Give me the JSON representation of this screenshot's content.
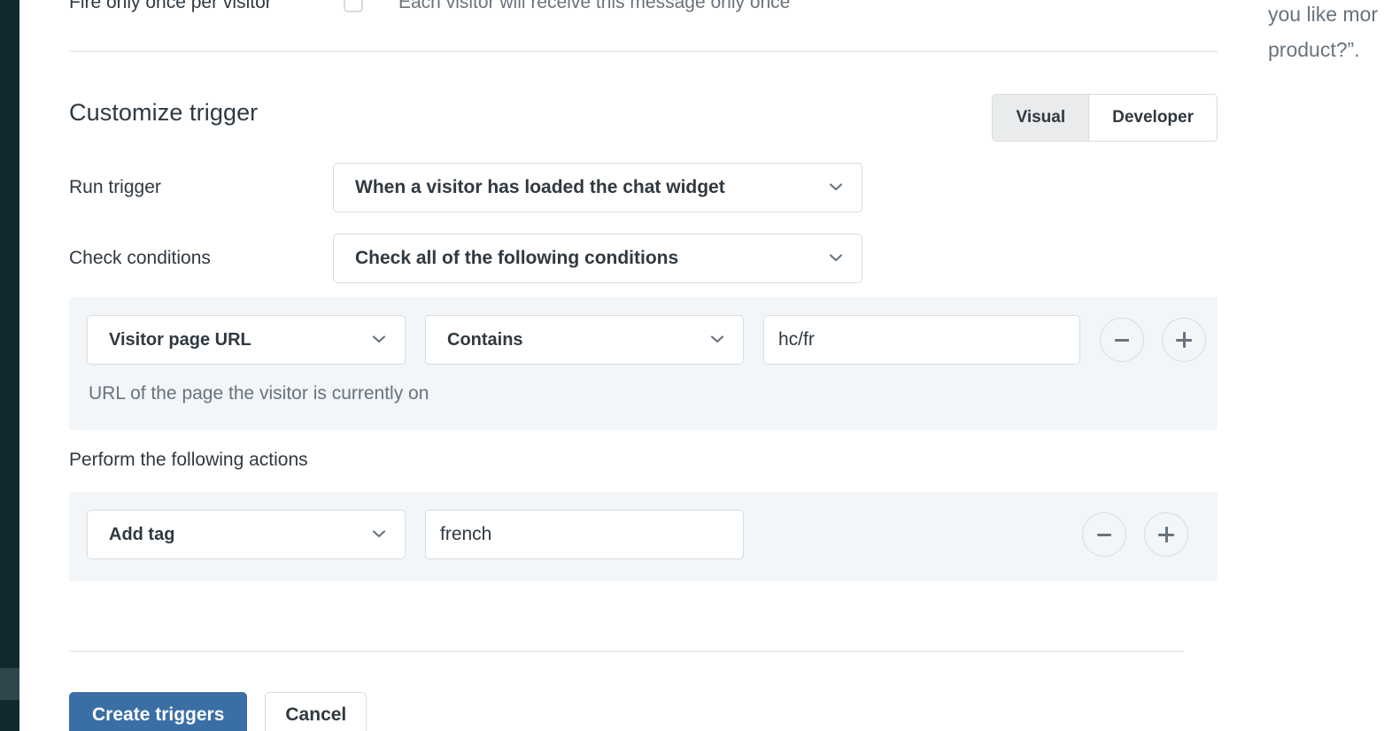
{
  "rail": {
    "name": "app-navigation-rail"
  },
  "fire_once": {
    "label": "Fire only once per visitor",
    "help_text": "Each visitor will receive this message only once",
    "checked": false
  },
  "section": {
    "title": "Customize trigger"
  },
  "mode_toggle": {
    "options": [
      {
        "label": "Visual",
        "selected": true
      },
      {
        "label": "Developer",
        "selected": false
      }
    ]
  },
  "run_trigger": {
    "label": "Run trigger",
    "value": "When a visitor has loaded the chat widget"
  },
  "check_conditions": {
    "label": "Check conditions",
    "value": "Check all of the following conditions"
  },
  "condition_row": {
    "field": "Visitor page URL",
    "operator": "Contains",
    "value": "hc/fr",
    "help_text": "URL of the page the visitor is currently on",
    "remove_label": "−",
    "add_label": "+"
  },
  "actions": {
    "heading": "Perform the following actions",
    "row": {
      "action": "Add tag",
      "value": "french",
      "remove_label": "−",
      "add_label": "+"
    }
  },
  "footer": {
    "submit_label": "Create triggers",
    "cancel_label": "Cancel"
  },
  "preview": {
    "quote_text": "you like mor\nproduct?”."
  },
  "colors": {
    "rail": "#12292e",
    "rail_active": "#2d474c",
    "panel_background": "#f2f6f9",
    "primary_button": "#3a6fa6",
    "text_primary": "#2f3941",
    "text_secondary": "#68737d",
    "border": "#d8dcde"
  }
}
